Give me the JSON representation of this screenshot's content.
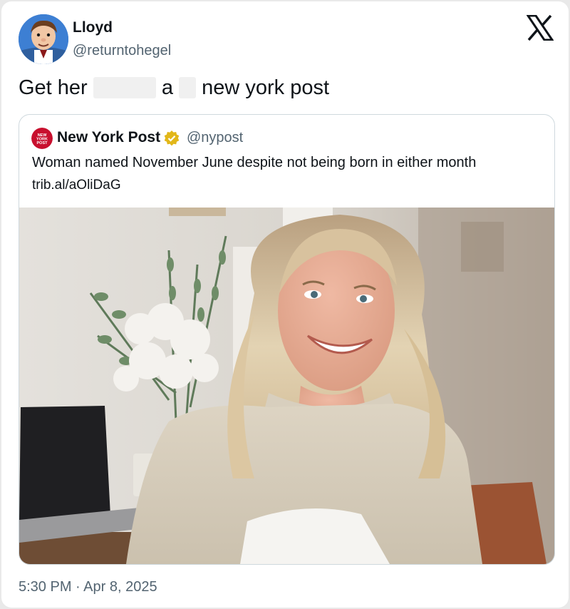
{
  "author": {
    "name": "Lloyd",
    "handle": "@returntohegel",
    "avatar_icon": "cartoon-man-avatar"
  },
  "platform": {
    "logo_icon": "x-logo-icon"
  },
  "tweet": {
    "text_part1": "Get her ",
    "text_part2": " a ",
    "text_part3": " new york post"
  },
  "quoted": {
    "name": "New York Post",
    "verified_icon": "gold-verified-badge-icon",
    "handle": "@nypost",
    "headline": "Woman named November June despite not being born in either month",
    "link": "trib.al/aOliDaG",
    "logo_text": "NEW YORK POST"
  },
  "timestamp": "5:30 PM · Apr 8, 2025",
  "colors": {
    "text": "#0f1419",
    "secondary": "#536471",
    "border": "#cfd9de",
    "verified": "#e2b719",
    "nypost_red": "#c8102e"
  }
}
